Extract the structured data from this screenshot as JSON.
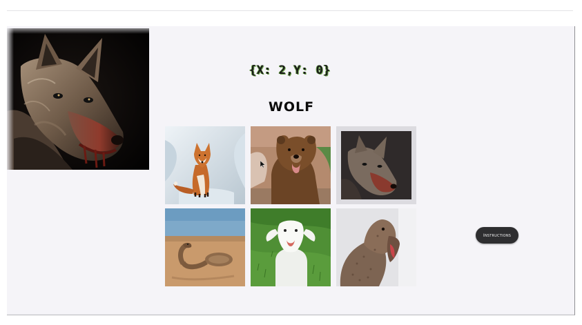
{
  "header": {
    "coordinates": "{X: 2,Y: 0}",
    "target_name": "WOLF"
  },
  "feature_image": {
    "subject": "wolf",
    "icon": "wolf-portrait"
  },
  "grid": {
    "cells": [
      {
        "animal": "fox",
        "selected": false
      },
      {
        "animal": "bear",
        "selected": false
      },
      {
        "animal": "wolf",
        "selected": true
      },
      {
        "animal": "snake",
        "selected": false
      },
      {
        "animal": "goat",
        "selected": false
      },
      {
        "animal": "mongoose",
        "selected": false
      }
    ]
  },
  "controls": {
    "instructions_label": "Instructions"
  },
  "colors": {
    "background": "#f5f4f8",
    "button": "#2e2e30",
    "coord_outline": "#6ba34a",
    "selected_border": "#dcdbe0"
  }
}
